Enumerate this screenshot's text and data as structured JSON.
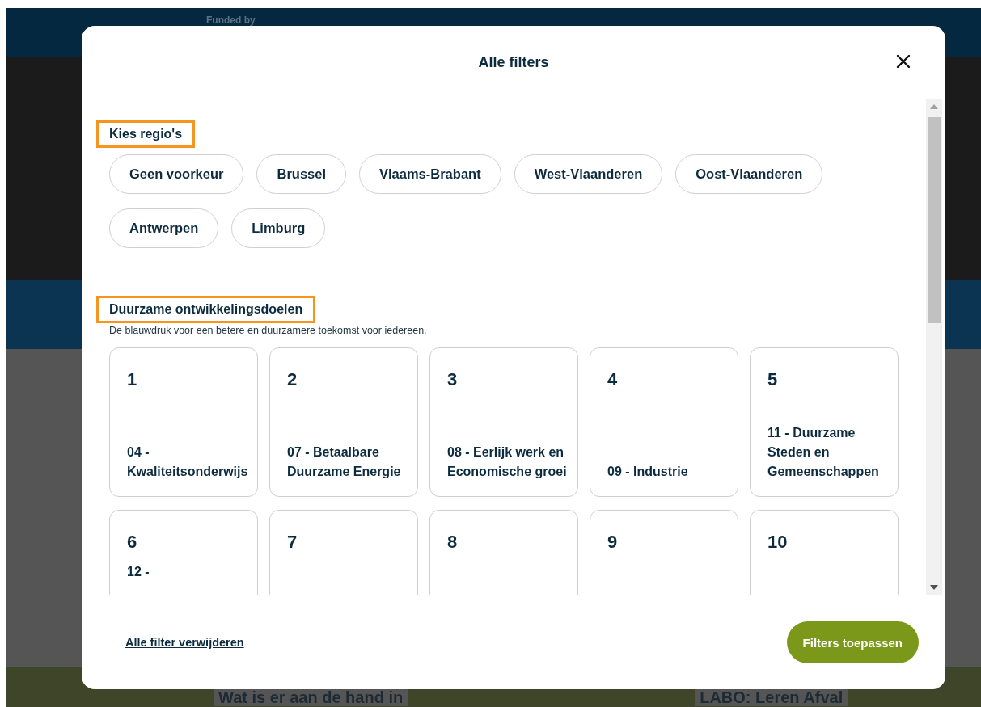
{
  "background_page": {
    "header_text": "Funded by",
    "card_titles": [
      "Wat is er aan de hand in",
      "LABO: Leren Afval"
    ]
  },
  "dialog": {
    "title": "Alle filters",
    "sections": [
      {
        "kind": "chips",
        "heading": "Kies regio's",
        "highlighted": true,
        "options": [
          {
            "label": "Geen voorkeur",
            "selected": false
          },
          {
            "label": "Brussel",
            "selected": false
          },
          {
            "label": "Vlaams-Brabant",
            "selected": false
          },
          {
            "label": "West-Vlaanderen",
            "selected": false
          },
          {
            "label": "Oost-Vlaanderen",
            "selected": false
          },
          {
            "label": "Antwerpen",
            "selected": false
          },
          {
            "label": "Limburg",
            "selected": false
          }
        ]
      },
      {
        "kind": "cards",
        "heading": "Duurzame ontwikkelingsdoelen",
        "highlighted": true,
        "subtitle": "De blauwdruk voor een betere en duurzamere toekomst voor iedereen.",
        "options": [
          {
            "number": "1",
            "label": "04 - Kwaliteitsonderwijs",
            "selected": false,
            "label_cut": false
          },
          {
            "number": "2",
            "label": "07 - Betaalbare Duurzame Energie",
            "selected": false,
            "label_cut": false
          },
          {
            "number": "3",
            "label": "08 - Eerlijk werk en Economische groei",
            "selected": false,
            "label_cut": false
          },
          {
            "number": "4",
            "label": "09 - Industrie",
            "selected": false,
            "label_cut": false
          },
          {
            "number": "5",
            "label": "11 - Duurzame Steden en Gemeenschappen",
            "selected": false,
            "label_cut": false
          },
          {
            "number": "6",
            "label": "12 -",
            "selected": false,
            "label_cut": true
          },
          {
            "number": "7",
            "selected": false
          },
          {
            "number": "8",
            "selected": false
          },
          {
            "number": "9",
            "selected": false
          },
          {
            "number": "10",
            "selected": false
          }
        ]
      }
    ],
    "footer": {
      "clear_link": "Alle filter verwijderen",
      "apply_button": "Filters toepassen"
    }
  }
}
